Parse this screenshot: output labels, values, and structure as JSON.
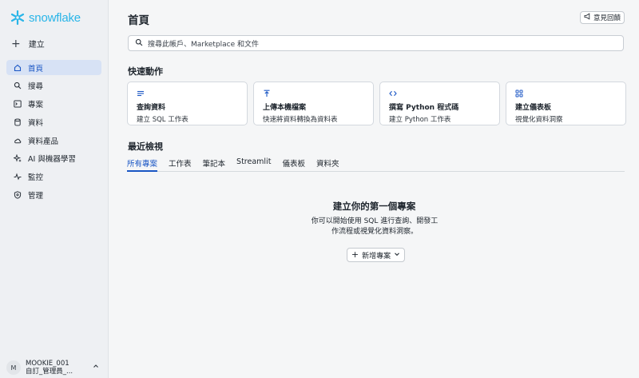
{
  "brand": {
    "logo_text": "snowflake",
    "color": "#29b5e8"
  },
  "sidebar": {
    "create_label": "建立",
    "items": [
      {
        "label": "首頁",
        "icon": "home-icon",
        "active": true
      },
      {
        "label": "搜尋",
        "icon": "search-icon"
      },
      {
        "label": "專案",
        "icon": "terminal-icon"
      },
      {
        "label": "資料",
        "icon": "database-icon"
      },
      {
        "label": "資料產品",
        "icon": "cloud-icon"
      },
      {
        "label": "AI 與機器學習",
        "icon": "sparkle-icon"
      },
      {
        "label": "監控",
        "icon": "activity-icon"
      },
      {
        "label": "管理",
        "icon": "shield-icon"
      }
    ],
    "user": {
      "initial": "M",
      "name": "MOOKIE_001",
      "role": "自訂_管理員_..."
    }
  },
  "header": {
    "title": "首頁",
    "feedback_label": "意見回饋"
  },
  "search": {
    "placeholder": "搜尋此帳戶、Marketplace 和文件"
  },
  "quick_actions": {
    "title": "快速動作",
    "cards": [
      {
        "title": "查詢資料",
        "subtitle": "建立 SQL 工作表",
        "icon": "lines-icon"
      },
      {
        "title": "上傳本機檔案",
        "subtitle": "快速將資料轉換為資料表",
        "icon": "upload-icon"
      },
      {
        "title": "撰寫 Python 程式碼",
        "subtitle": "建立 Python 工作表",
        "icon": "code-icon"
      },
      {
        "title": "建立儀表板",
        "subtitle": "視覺化資料洞察",
        "icon": "grid-icon"
      }
    ]
  },
  "recent": {
    "title": "最近檢視",
    "tabs": [
      "所有專案",
      "工作表",
      "筆記本",
      "Streamlit",
      "儀表板",
      "資料夾"
    ],
    "active_tab": 0,
    "empty_title": "建立你的第一個專案",
    "empty_desc": "你可以開始使用 SQL 進行查詢、開發工作流程或視覺化資料洞察。",
    "new_button": "新增專案"
  },
  "colors": {
    "accent": "#1a56c4",
    "active_bg": "#d7e2f5"
  }
}
